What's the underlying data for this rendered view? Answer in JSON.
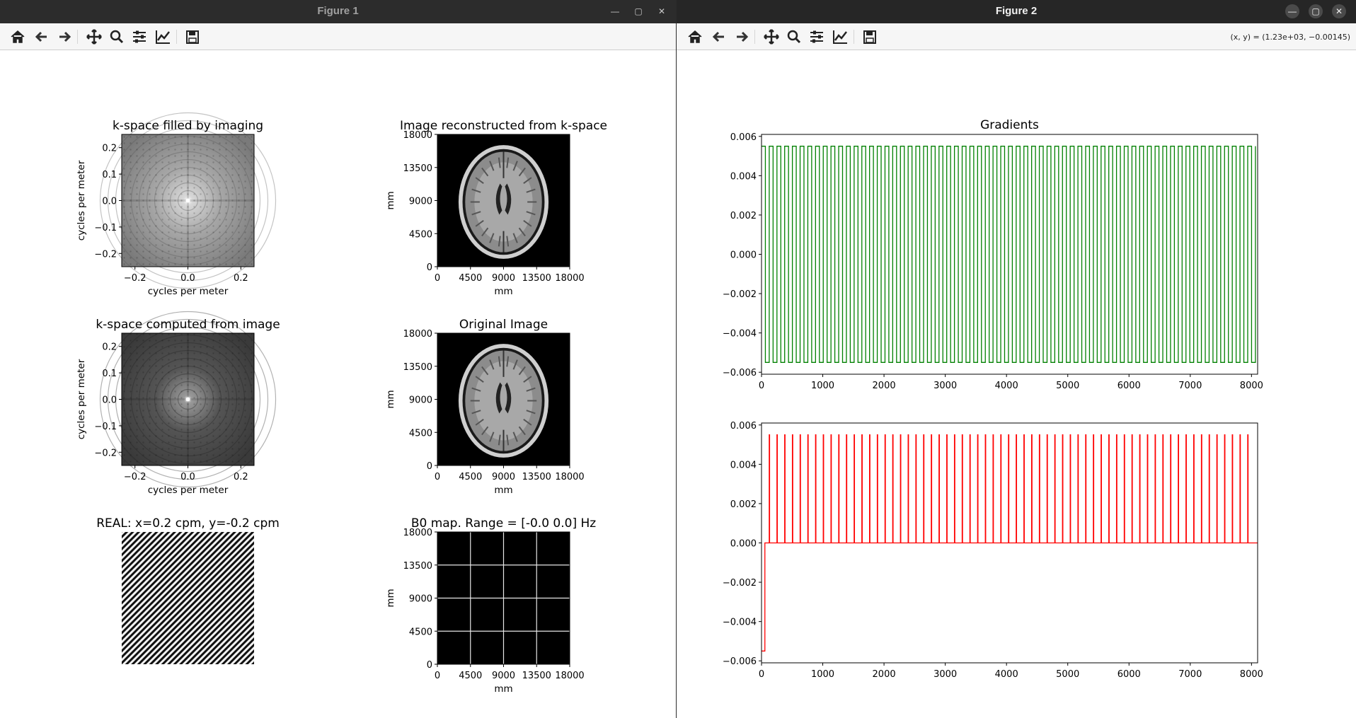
{
  "figure1": {
    "title": "Figure 1",
    "toolbar": [
      "home-icon",
      "back-icon",
      "forward-icon",
      "pan-icon",
      "zoom-icon",
      "configure-subplots-icon",
      "edit-axis-icon",
      "save-icon"
    ],
    "subplots": [
      {
        "title": "k-space filled by imaging",
        "xlabel": "cycles per meter",
        "ylabel": "cycles per meter",
        "kind": "kspace",
        "xticks": [
          "−0.2",
          "0.0",
          "0.2"
        ],
        "yticks": [
          "0.2",
          "0.1",
          "0.0",
          "−0.1",
          "−0.2"
        ]
      },
      {
        "title": "Image reconstructed from k-space",
        "xlabel": "mm",
        "ylabel": "mm",
        "kind": "brain",
        "xticks": [
          "0",
          "4500",
          "9000",
          "13500",
          "18000"
        ],
        "yticks": [
          "18000",
          "13500",
          "9000",
          "4500",
          "0"
        ]
      },
      {
        "title": "k-space computed from image",
        "xlabel": "cycles per meter",
        "ylabel": "cycles per meter",
        "kind": "kspace-dark",
        "xticks": [
          "−0.2",
          "0.0",
          "0.2"
        ],
        "yticks": [
          "0.2",
          "0.1",
          "0.0",
          "−0.1",
          "−0.2"
        ]
      },
      {
        "title": "Original Image",
        "xlabel": "mm",
        "ylabel": "mm",
        "kind": "brain",
        "xticks": [
          "0",
          "4500",
          "9000",
          "13500",
          "18000"
        ],
        "yticks": [
          "18000",
          "13500",
          "9000",
          "4500",
          "0"
        ]
      },
      {
        "title": "REAL: x=0.2 cpm, y=-0.2 cpm",
        "xlabel": "",
        "ylabel": "",
        "kind": "stripes",
        "xticks": [],
        "yticks": []
      },
      {
        "title": "B0 map. Range = [-0.0 0.0] Hz",
        "xlabel": "mm",
        "ylabel": "mm",
        "kind": "b0",
        "xticks": [
          "0",
          "4500",
          "9000",
          "13500",
          "18000"
        ],
        "yticks": [
          "18000",
          "13500",
          "9000",
          "4500",
          "0"
        ]
      }
    ]
  },
  "figure2": {
    "title": "Figure 2",
    "coords": "(x, y) = (1.23e+03, −0.00145)",
    "toolbar": [
      "home-icon",
      "back-icon",
      "forward-icon",
      "pan-icon",
      "zoom-icon",
      "configure-subplots-icon",
      "edit-axis-icon",
      "save-icon"
    ],
    "colors": {
      "top": "#008000",
      "bottom": "#ff0000"
    }
  },
  "chart_data": [
    {
      "type": "line",
      "title": "Gradients",
      "xlabel": "",
      "ylabel": "",
      "xlim": [
        0,
        8100
      ],
      "ylim": [
        -0.0061,
        0.0061
      ],
      "xticks": [
        0,
        1000,
        2000,
        3000,
        4000,
        5000,
        6000,
        7000,
        8000
      ],
      "yticks": [
        0.006,
        0.004,
        0.002,
        0.0,
        -0.002,
        -0.004,
        -0.006
      ],
      "series": [
        {
          "color": "#008000",
          "description_of_shape": "square wave alternating between 0.0055 and -0.0055, 64 periods of 126, starting high at x=0",
          "high": 0.0055,
          "low": -0.0055,
          "period": 126,
          "cycles": 64
        }
      ]
    },
    {
      "type": "line",
      "title": "",
      "xlabel": "",
      "ylabel": "",
      "xlim": [
        0,
        8100
      ],
      "ylim": [
        -0.0061,
        0.0061
      ],
      "xticks": [
        0,
        1000,
        2000,
        3000,
        4000,
        5000,
        6000,
        7000,
        8000
      ],
      "yticks": [
        0.006,
        0.004,
        0.002,
        0.0,
        -0.002,
        -0.004,
        -0.006
      ],
      "series": [
        {
          "color": "#ff0000",
          "initial_value": -0.0055,
          "initial_until": 55,
          "baseline": 0.0,
          "spike": 0.0055,
          "spike_period": 126,
          "spike_start": 126,
          "spike_width": 6,
          "spike_count": 63
        }
      ]
    }
  ]
}
